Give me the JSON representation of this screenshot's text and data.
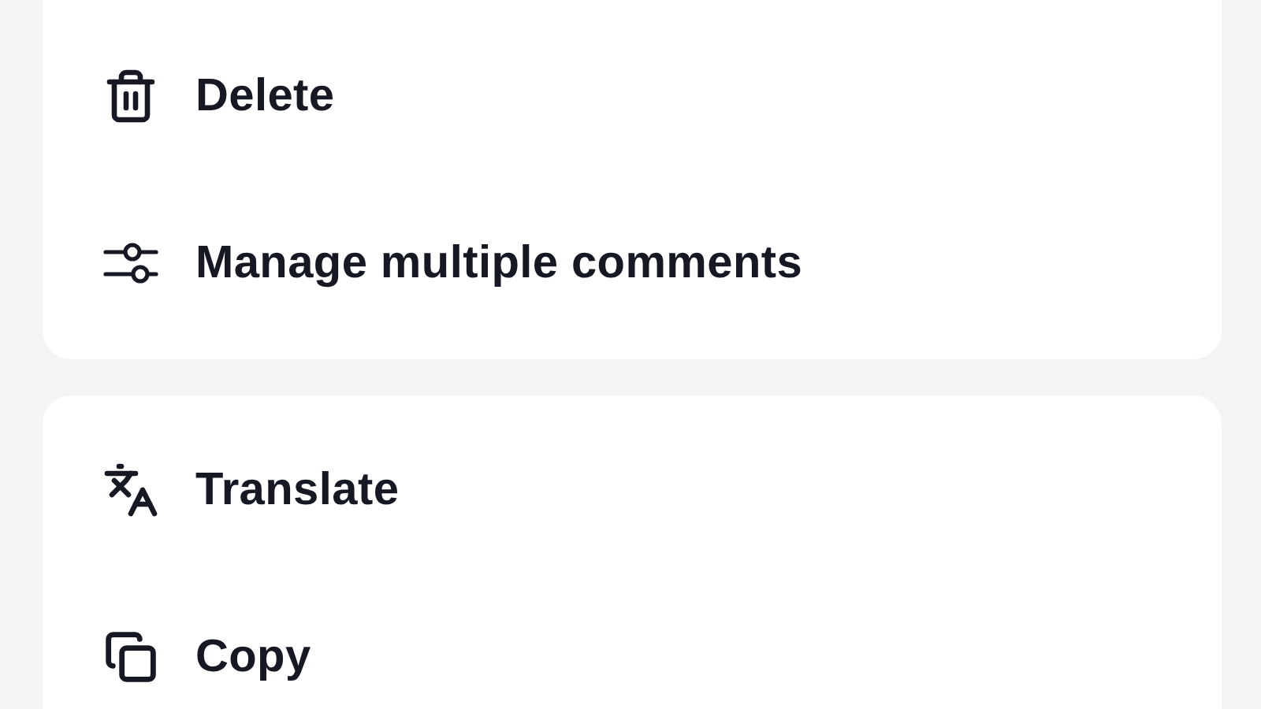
{
  "menu_groups": [
    {
      "items": [
        {
          "label": "Delete",
          "kind": "trash"
        },
        {
          "label": "Manage multiple comments",
          "kind": "sliders"
        }
      ]
    },
    {
      "items": [
        {
          "label": "Translate",
          "kind": "translate"
        },
        {
          "label": "Copy",
          "kind": "copy"
        }
      ]
    }
  ]
}
